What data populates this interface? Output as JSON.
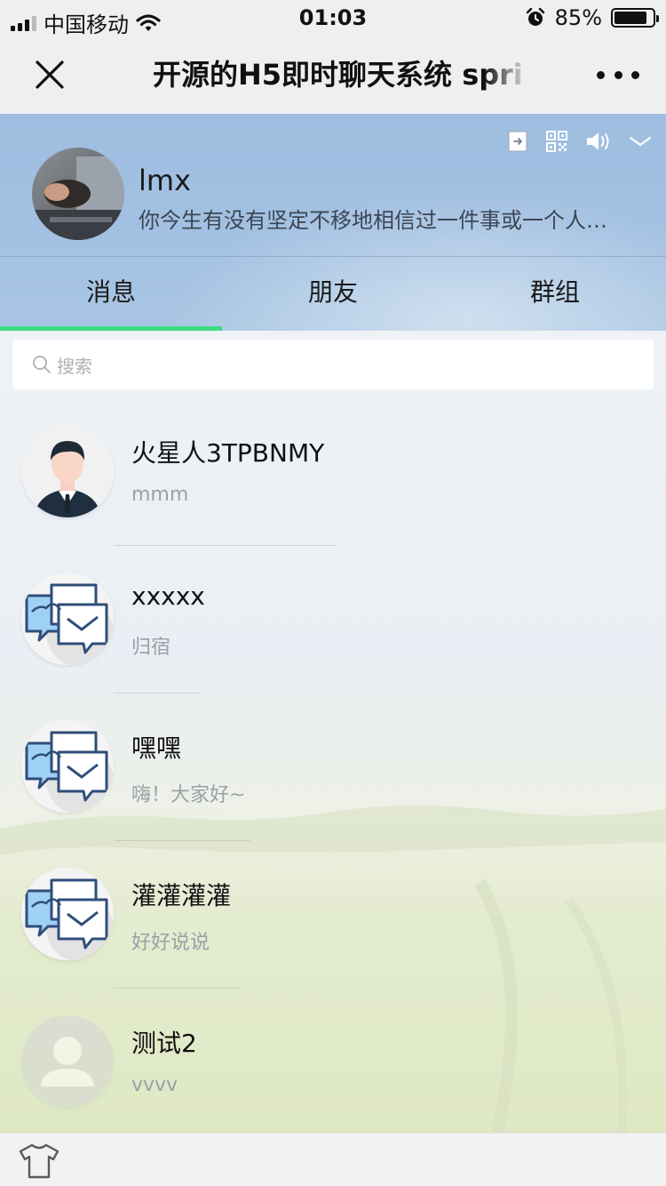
{
  "status_bar": {
    "carrier": "中国移动",
    "time": "01:03",
    "battery": "85%",
    "battery_level": 0.85
  },
  "nav": {
    "title": "开源的H5即时聊天系统 spri",
    "close_icon": "close-icon",
    "more_icon": "more-dots-icon"
  },
  "profile": {
    "name": "lmx",
    "signature": "你今生有没有坚定不移地相信过一件事或一个人…",
    "tools": [
      "logout-icon",
      "qrcode-icon",
      "volume-icon",
      "chevron-down-icon"
    ]
  },
  "tabs": [
    {
      "label": "消息",
      "active": true
    },
    {
      "label": "朋友",
      "active": false
    },
    {
      "label": "群组",
      "active": false
    }
  ],
  "search": {
    "placeholder": "搜索"
  },
  "chats": [
    {
      "name": "火星人3TPBNMY",
      "message": "mmm",
      "avatar": "businessman-avatar"
    },
    {
      "name": "xxxxx",
      "message": "归宿",
      "avatar": "group-chat-avatar"
    },
    {
      "name": "嘿嘿",
      "message": "嗨！大家好~",
      "avatar": "group-chat-avatar"
    },
    {
      "name": "灌灌灌灌",
      "message": "好好说说",
      "avatar": "group-chat-avatar"
    },
    {
      "name": "测试2",
      "message": "vvvv",
      "avatar": "default-user-avatar"
    }
  ],
  "bottom_bar": {
    "icon": "shirt-icon"
  },
  "colors": {
    "accent": "#3ddc84",
    "header_bg": "#a3c1e2",
    "nav_bg": "#efeff0"
  }
}
